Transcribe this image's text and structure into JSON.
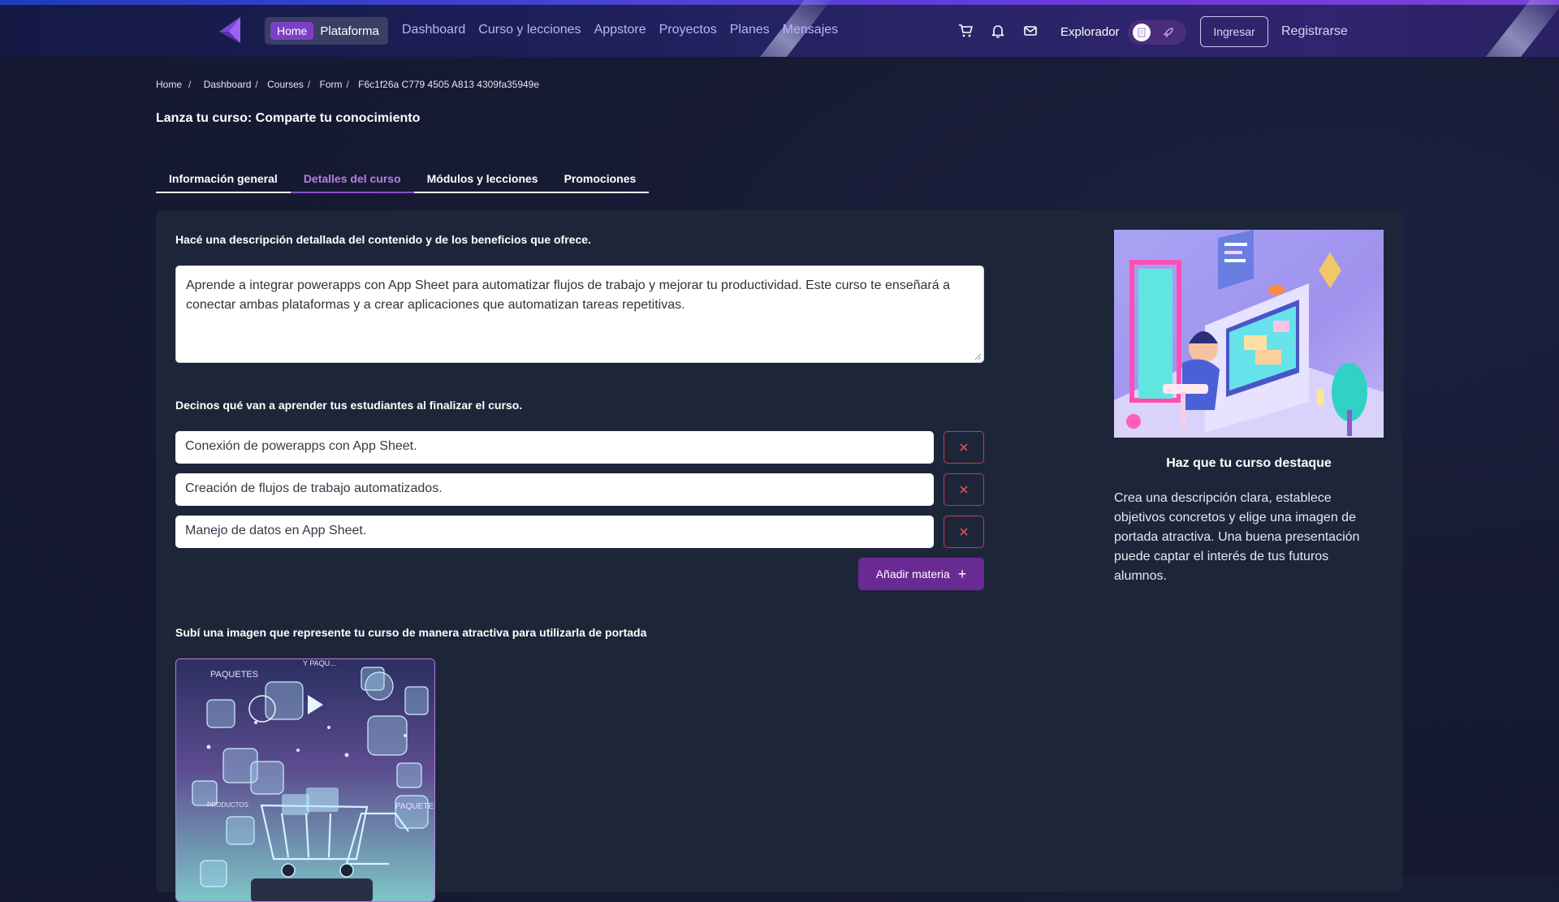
{
  "nav": {
    "home_badge": "Home",
    "platform": "Plataforma",
    "links": [
      "Dashboard",
      "Curso y lecciones",
      "Appstore",
      "Proyectos",
      "Planes",
      "Mensajes"
    ],
    "explorer_label": "Explorador",
    "login_label": "Ingresar",
    "register_label": "Registrarse"
  },
  "breadcrumb": [
    "Home",
    "Dashboard",
    "Courses",
    "Form",
    "F6c1f26a C779 4505 A813 4309fa35949e"
  ],
  "page_title": "Lanza tu curso: Comparte tu conocimiento",
  "tabs": [
    {
      "label": "Información general",
      "active": false
    },
    {
      "label": "Detalles del curso",
      "active": true
    },
    {
      "label": "Módulos y lecciones",
      "active": false
    },
    {
      "label": "Promociones",
      "active": false
    }
  ],
  "form": {
    "description_label": "Hacé una descripción detallada del contenido y de los beneficios que ofrece.",
    "description_value": "Aprende a integrar powerapps con App Sheet para automatizar flujos de trabajo y mejorar tu productividad.  Este curso te enseñará a conectar ambas plataformas y a crear aplicaciones que automatizan tareas repetitivas.",
    "objectives_label": "Decinos qué van a aprender tus estudiantes al finalizar el curso.",
    "objectives": [
      "Conexión de powerapps con App Sheet.",
      "Creación de flujos de trabajo automatizados.",
      "Manejo de datos en App Sheet."
    ],
    "add_label": "Añadir materia",
    "cover_label": "Subí una imagen que represente tu curso de manera atractiva para utilizarla de portada",
    "cover_texts": [
      "PAQUETES",
      "Y PAQU...",
      "PRODUCTOS",
      "PAQUETES"
    ]
  },
  "side": {
    "title": "Haz que tu curso destaque",
    "text": "Crea una descripción clara, establece objetivos concretos y elige una imagen de portada atractiva. Una buena presentación puede captar el interés de tus futuros alumnos."
  },
  "colors": {
    "accent": "#7d3fc4",
    "tab_active": "#b77ee6",
    "add_button": "#6a2a94",
    "danger": "#c43d4b",
    "card": "#1d2638"
  },
  "icons": [
    "logo-icon",
    "cart-icon",
    "bell-icon",
    "mail-icon",
    "building-icon",
    "rocket-icon",
    "close-icon",
    "plus-icon"
  ]
}
